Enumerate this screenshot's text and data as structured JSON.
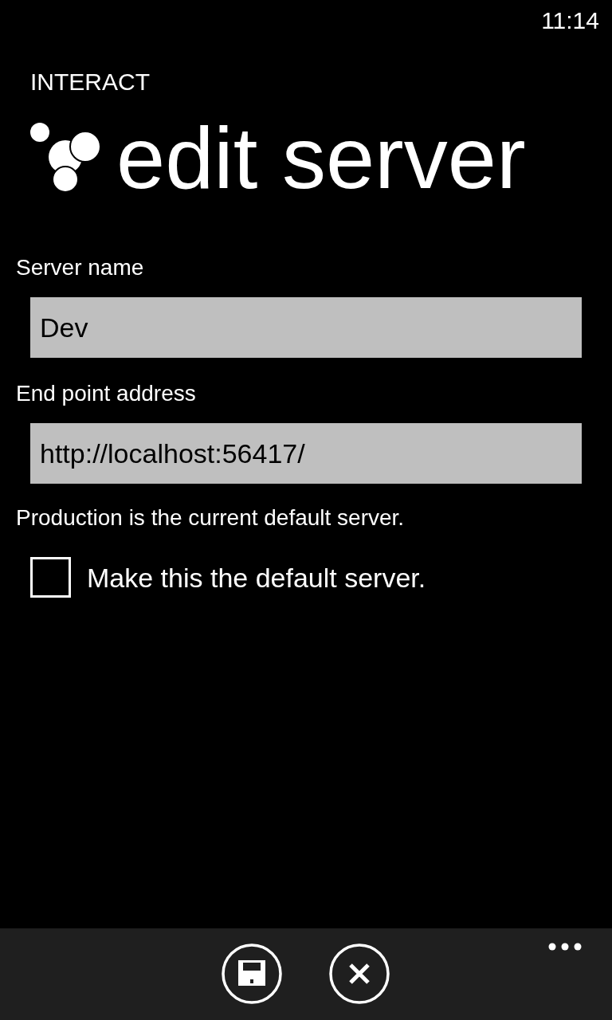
{
  "status_bar": {
    "time": "11:14"
  },
  "app": {
    "title": "INTERACT"
  },
  "page": {
    "title": "edit server"
  },
  "fields": [
    {
      "label": "Server name",
      "value": "Dev"
    },
    {
      "label": "End point address",
      "value": "http://localhost:56417/"
    }
  ],
  "note": "Production is the current default server.",
  "default_checkbox": {
    "label": "Make this the default server.",
    "checked": false
  },
  "app_bar": {
    "buttons": [
      {
        "kind": "save"
      },
      {
        "kind": "cancel"
      }
    ]
  }
}
